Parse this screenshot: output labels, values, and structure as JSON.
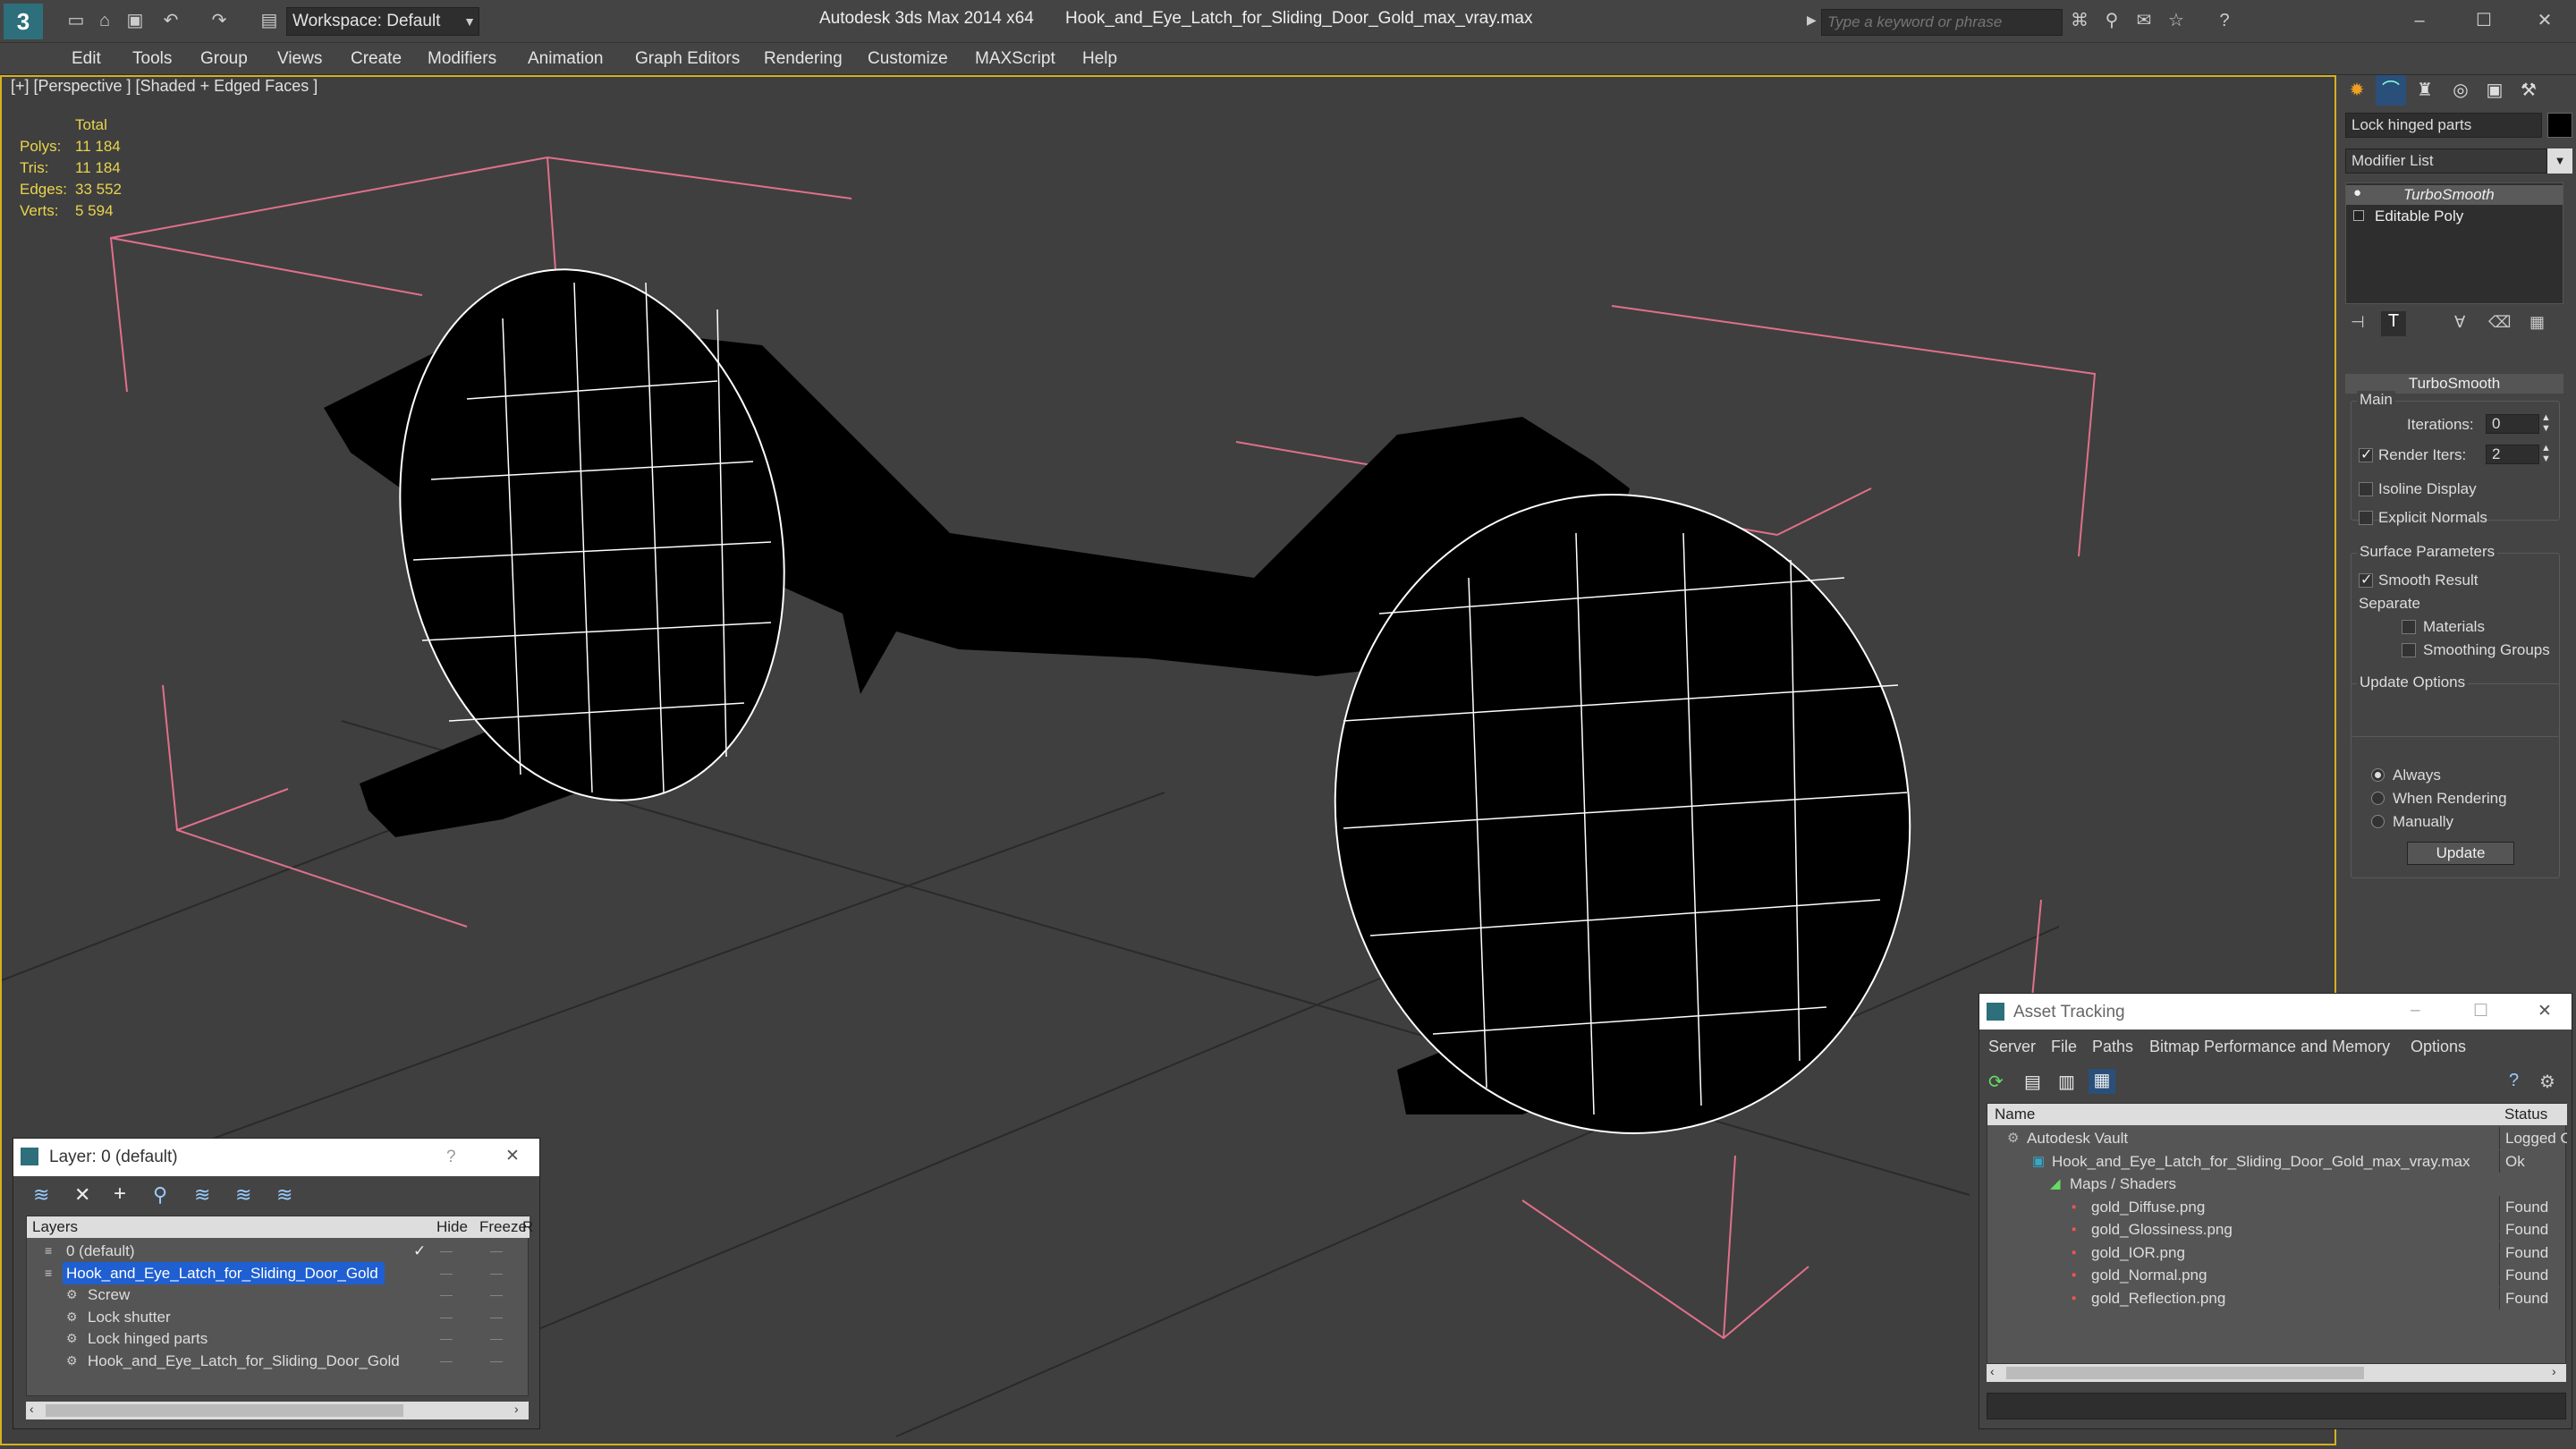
{
  "title_bar": {
    "workspace_label": "Workspace: Default",
    "title_app": "Autodesk 3ds Max  2014 x64",
    "title_file": "Hook_and_Eye_Latch_for_Sliding_Door_Gold_max_vray.max",
    "search_placeholder": "Type a keyword or phrase"
  },
  "menu": [
    "Edit",
    "Tools",
    "Group",
    "Views",
    "Create",
    "Modifiers",
    "Animation",
    "Graph Editors",
    "Rendering",
    "Customize",
    "MAXScript",
    "Help"
  ],
  "viewport": {
    "label": "[+] [Perspective ] [Shaded + Edged Faces ]",
    "stats_header": "Total",
    "stats": [
      {
        "label": "Polys:",
        "value": "11 184"
      },
      {
        "label": "Tris:",
        "value": "11 184"
      },
      {
        "label": "Edges:",
        "value": "33 552"
      },
      {
        "label": "Verts:",
        "value": "5 594"
      }
    ]
  },
  "command_panel": {
    "object_name": "Lock hinged parts",
    "modifier_list": "Modifier List",
    "stack": [
      "TurboSmooth",
      "Editable Poly"
    ],
    "rollout_title": "TurboSmooth",
    "main_label": "Main",
    "iterations_label": "Iterations:",
    "iterations_value": "0",
    "render_iters_label": "Render Iters:",
    "render_iters_value": "2",
    "render_iters_checked": true,
    "isoline_label": "Isoline Display",
    "explicit_label": "Explicit Normals",
    "surface_label": "Surface Parameters",
    "smooth_label": "Smooth Result",
    "smooth_checked": true,
    "separate_label": "Separate",
    "materials_label": "Materials",
    "smoothing_groups_label": "Smoothing Groups",
    "update_options_label": "Update Options",
    "always_label": "Always",
    "when_rendering_label": "When Rendering",
    "manually_label": "Manually",
    "update_button": "Update"
  },
  "layer_window": {
    "title": "Layer: 0 (default)",
    "help": "?",
    "col_layers": "Layers",
    "col_hide": "Hide",
    "col_freeze": "Freeze",
    "col_r": "R",
    "rows": [
      {
        "name": "0 (default)",
        "indent": 1,
        "selected": false,
        "checked": true
      },
      {
        "name": "Hook_and_Eye_Latch_for_Sliding_Door_Gold",
        "indent": 1,
        "selected": true,
        "checked": false
      },
      {
        "name": "Screw",
        "indent": 2,
        "selected": false,
        "checked": false
      },
      {
        "name": "Lock shutter",
        "indent": 2,
        "selected": false,
        "checked": false
      },
      {
        "name": "Lock hinged parts",
        "indent": 2,
        "selected": false,
        "checked": false
      },
      {
        "name": "Hook_and_Eye_Latch_for_Sliding_Door_Gold",
        "indent": 2,
        "selected": false,
        "checked": false
      }
    ]
  },
  "asset_window": {
    "title": "Asset Tracking",
    "menu": [
      "Server",
      "File",
      "Paths",
      "Bitmap Performance and Memory",
      "Options"
    ],
    "col_name": "Name",
    "col_status": "Status",
    "rows": [
      {
        "name": "Autodesk Vault",
        "status": "Logged Ou",
        "indent": 1,
        "icon": "vault"
      },
      {
        "name": "Hook_and_Eye_Latch_for_Sliding_Door_Gold_max_vray.max",
        "status": "Ok",
        "indent": 2,
        "icon": "max"
      },
      {
        "name": "Maps / Shaders",
        "status": "",
        "indent": 3,
        "icon": "maps"
      },
      {
        "name": "gold_Diffuse.png",
        "status": "Found",
        "indent": 4,
        "icon": "png"
      },
      {
        "name": "gold_Glossiness.png",
        "status": "Found",
        "indent": 4,
        "icon": "png"
      },
      {
        "name": "gold_IOR.png",
        "status": "Found",
        "indent": 4,
        "icon": "png"
      },
      {
        "name": "gold_Normal.png",
        "status": "Found",
        "indent": 4,
        "icon": "png"
      },
      {
        "name": "gold_Reflection.png",
        "status": "Found",
        "indent": 4,
        "icon": "png"
      }
    ]
  },
  "colors": {
    "accent": "#1f5fd1",
    "viewport_border": "#d6b01e",
    "stats_text": "#e8d44d",
    "bbox_lines": "#e0708a"
  }
}
